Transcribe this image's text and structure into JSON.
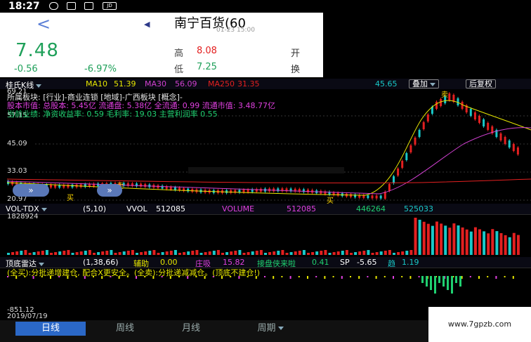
{
  "status_bar": {
    "time": "18:27",
    "icons": [
      "message-icon",
      "sms-icon",
      "app-icon",
      "jd-icon"
    ],
    "jd_label": "JD"
  },
  "header": {
    "title": "南宁百货(60",
    "datetime": "01-23 15:00",
    "price": "7.48",
    "change": "-0.56",
    "change_pct": "-6.97%",
    "high_label": "高",
    "high": "8.08",
    "low_label": "低",
    "low": "7.25",
    "open_label_trunc": "开",
    "turnover_label_trunc": "换"
  },
  "kline_bar": {
    "type_label": "桂氏K线",
    "ma10": "MA10",
    "ma10_val": "51.39",
    "ma30": "MA30",
    "ma30_val": "56.09",
    "ma250": "MA250",
    "ma250_val": "31.35",
    "extra_val": "45.65",
    "overlay_button": "叠加",
    "adjust_button": "后复权"
  },
  "price_axis": {
    "top": "69.21",
    "t2": "57.15",
    "t3": "45.09",
    "t4": "33.03",
    "bottom": "20.97"
  },
  "info_lines": {
    "line1": "所属板块: [行业]-商业连锁 [地域]-广西板块 [概念]-",
    "line2": "股本市值: 总股本: 5.45亿 流通盘: 5.38亿 全流通: 0.99 流通市值: 3.48.77亿",
    "line3": "当前业绩: 净资收益率: 0.59 毛利率: 19.03 主营利润率 0.55"
  },
  "markers": {
    "buy1": "买",
    "sell1": "卖",
    "buy2": "买",
    "sell2": "卖"
  },
  "vol_bar": {
    "label": "VOL-TDX",
    "params": "(5,10)",
    "vvol_label": "VVOL",
    "vvol": "512085",
    "volume_label": "VOLUME",
    "volume": "512085",
    "v2": "446264",
    "v3": "525033",
    "axis_top": "1828924"
  },
  "radar_bar": {
    "label": "顶底雷达",
    "params": "(1,38,66)",
    "assist_label": "辅助",
    "assist": "0.00",
    "zhuang_label": "庄吸",
    "zhuang": "15.82",
    "jiepan_label": "接盘侠来啦",
    "jiepan": "0.41",
    "sp_label": "SP",
    "sp": "-5.65",
    "trend_label": "趋",
    "trend": "1.19",
    "note": "(全买):分批递增建仓, 配合X更安全。(全卖):分批递减减仓。(顶底不建仓!)",
    "axis_bottom": "-851.12",
    "date": "2019/07/19"
  },
  "tabs": {
    "day": "日线",
    "week": "周线",
    "month": "月线",
    "period": "周期"
  },
  "watermark": "www.7gpzb.com",
  "colors": {
    "up": "#e32020",
    "down": "#19c9c9",
    "accent": "#2b68c7",
    "price_green": "#1fa05a",
    "ma_yellow": "#e6e600",
    "ma_magenta": "#d040d0"
  }
}
